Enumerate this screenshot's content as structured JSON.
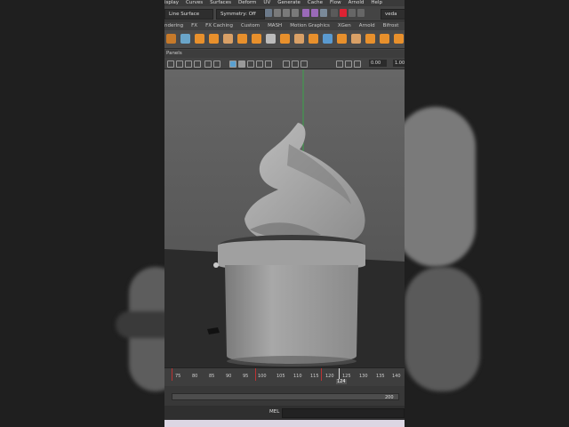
{
  "menu": [
    "isplay",
    "Curves",
    "Surfaces",
    "Deform",
    "UV",
    "Generate",
    "Cache",
    "Flow",
    "Arnold",
    "Help"
  ],
  "status": {
    "mode_field": "Line Surface",
    "symmetry_field": "Symmetry: Off",
    "user_field": "veda"
  },
  "shelf_tabs": [
    "ndering",
    "FX",
    "FX Caching",
    "Custom",
    "MASH",
    "Motion Graphics",
    "XGen",
    "Arnold",
    "Bifrost"
  ],
  "panels_label": "Panels",
  "view_toolbar": {
    "value_a": "0.00",
    "value_b": "1.00"
  },
  "timeline": {
    "ticks": [
      "75",
      "80",
      "85",
      "90",
      "95",
      "100",
      "105",
      "110",
      "115",
      "120",
      "125",
      "130",
      "135",
      "140"
    ],
    "current_frame": "124"
  },
  "range": {
    "end_value": "200"
  },
  "command_line": {
    "label": "MEL"
  },
  "colors": {
    "viewport_bg": "#6a6a6a",
    "key_red": "#b33333",
    "shelf_orange": "#e8902c"
  }
}
